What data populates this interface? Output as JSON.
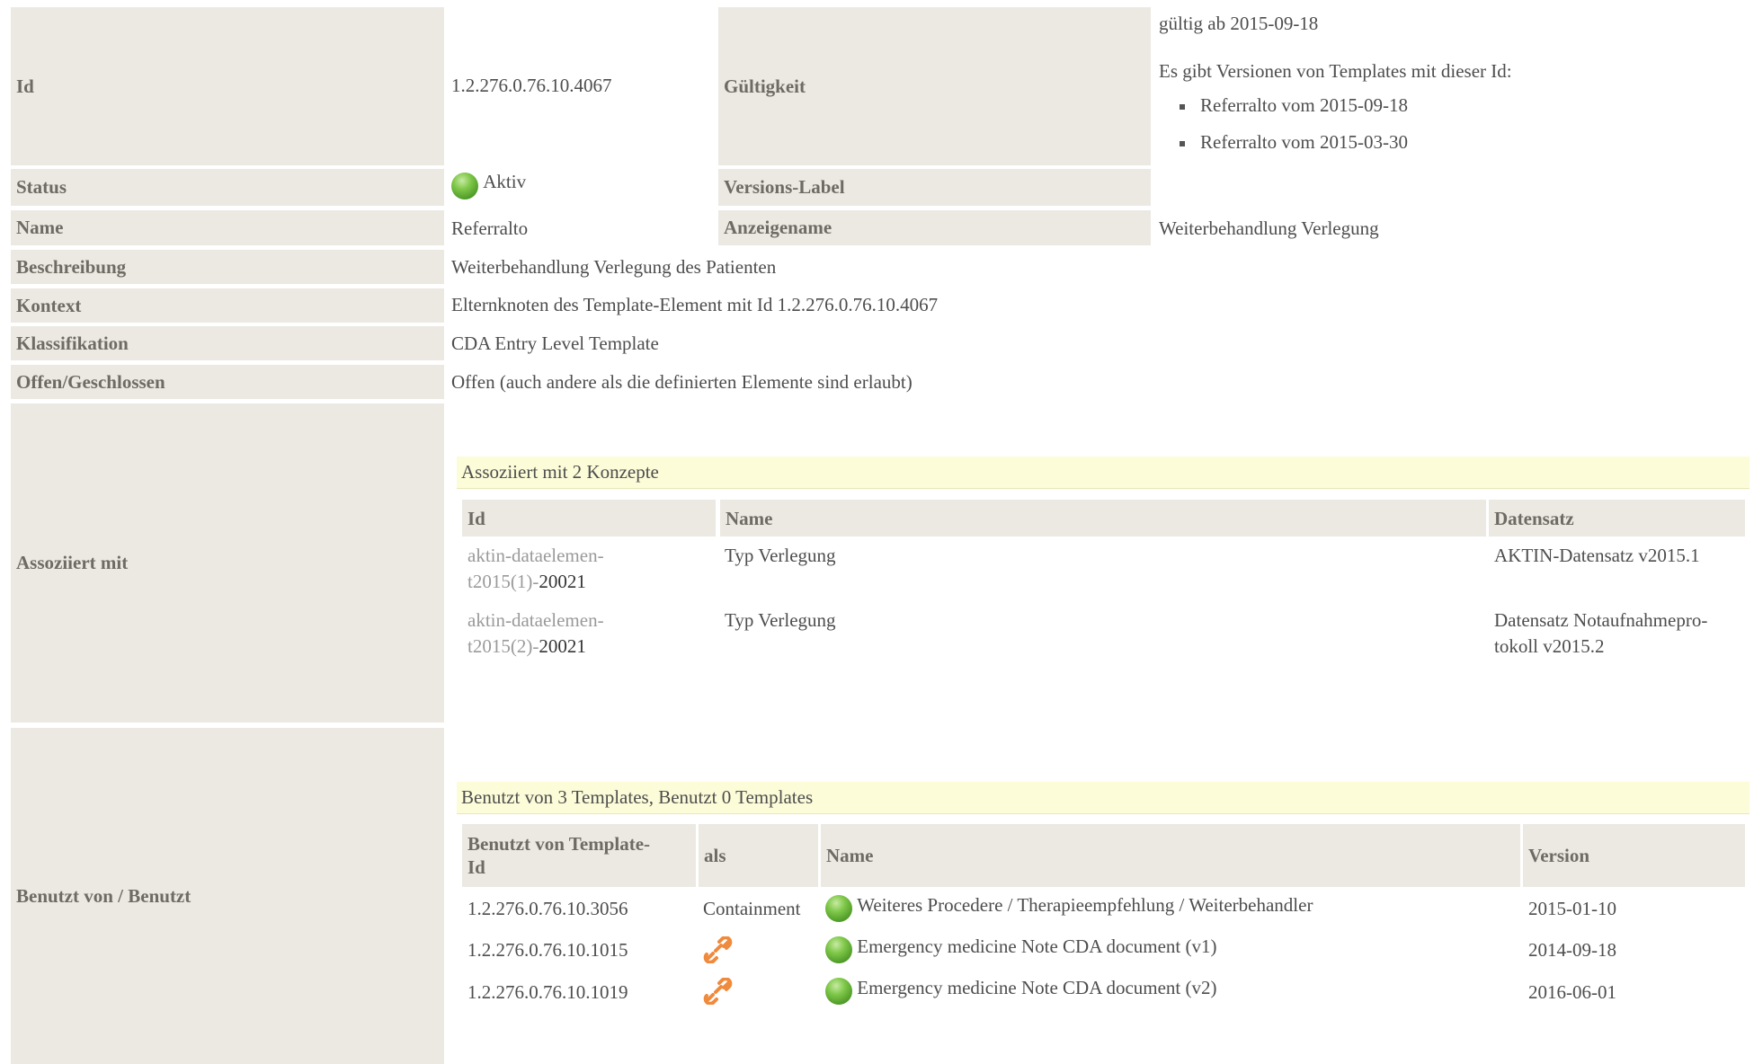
{
  "header": {
    "id_label": "Id",
    "id_value": "1.2.276.0.76.10.4067",
    "validity_label": "Gültigkeit",
    "validity_value": "gültig ab 2015-09-18",
    "versions_intro": "Es gibt Versionen von Templates mit dieser Id:",
    "versions": [
      "Referralto vom 2015-09-18",
      "Referralto vom 2015-03-30"
    ]
  },
  "status": {
    "label": "Status",
    "value": "Aktiv",
    "version_label_label": "Versions-Label"
  },
  "name": {
    "label": "Name",
    "value": "Referralto",
    "display_label": "Anzeigename",
    "display_value": "Weiterbehandlung Verlegung"
  },
  "description": {
    "label": "Beschreibung",
    "value": "Weiterbehandlung Verlegung des Patienten"
  },
  "context": {
    "label": "Kontext",
    "value": "Elternknoten des Template-Element mit Id 1.2.276.0.76.10.4067"
  },
  "classification": {
    "label": "Klassifikation",
    "value": "CDA Entry Level Template"
  },
  "open_closed": {
    "label": "Offen/Geschlossen",
    "value": "Offen (auch andere als die definierten Elemente sind erlaubt)"
  },
  "associated": {
    "label": "Assoziiert mit",
    "band": "Assoziiert mit 2 Konzepte",
    "columns": [
      "Id",
      "Name",
      "Datensatz"
    ],
    "rows": [
      {
        "id_line1": "aktin-dataelemen-",
        "id_line2_prefix": "t2015(1)-",
        "id_line2_num": "20021",
        "name": "Typ Verlegung",
        "dataset_line1": "AKTIN-Datensatz v2015.1",
        "dataset_line2": ""
      },
      {
        "id_line1": "aktin-dataelemen-",
        "id_line2_prefix": "t2015(2)-",
        "id_line2_num": "20021",
        "name": "Typ Verlegung",
        "dataset_line1": "Datensatz Notaufnahmepro-",
        "dataset_line2": "tokoll v2015.2"
      }
    ]
  },
  "usage": {
    "label": "Benutzt von / Benutzt",
    "band": "Benutzt von 3 Templates, Benutzt 0 Templates",
    "columns": {
      "template_id_line1": "Benutzt von Template-",
      "template_id_line2": "Id",
      "as": "als",
      "name": "Name",
      "version": "Version"
    },
    "rows": [
      {
        "template_id": "1.2.276.0.76.10.3056",
        "as": "Containment",
        "name": "Weiteres Procedere / Therapieempfehlung / Weiterbehandler",
        "version": "2015-01-10"
      },
      {
        "template_id": "1.2.276.0.76.10.1015",
        "as_icon": "link-icon",
        "name": "Emergency medicine Note CDA document (v1)",
        "version": "2014-09-18"
      },
      {
        "template_id": "1.2.276.0.76.10.1019",
        "as_icon": "link-icon",
        "name": "Emergency medicine Note CDA document (v2)",
        "version": "2016-06-01"
      }
    ]
  },
  "colors": {
    "label_bg": "#ece9e3",
    "band_bg": "#fcfcd9",
    "status_green": "#6cbb3c",
    "link_orange": "#f08a3c"
  }
}
